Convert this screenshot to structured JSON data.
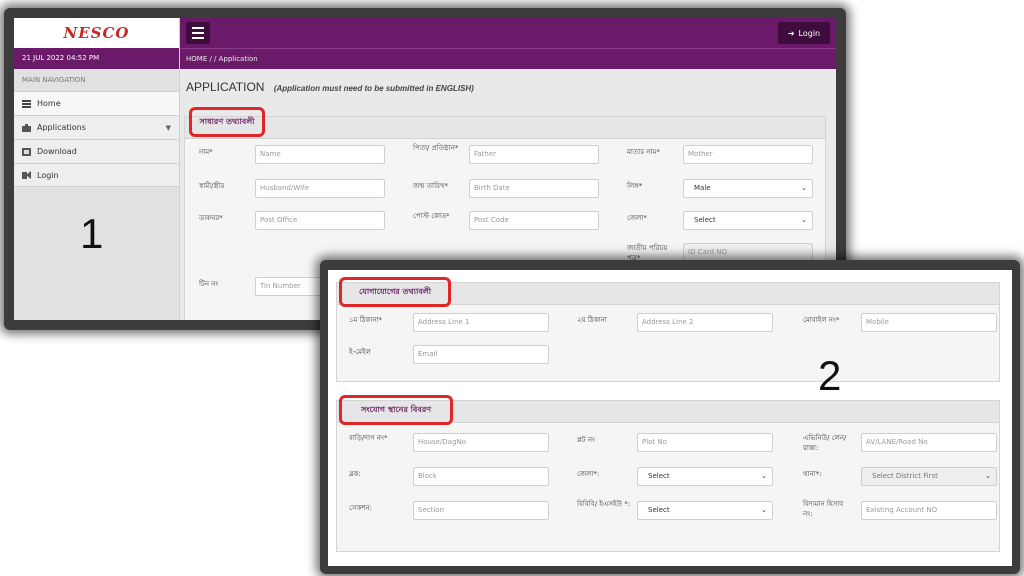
{
  "screen1": {
    "logo": "NESCO",
    "date": "21 JUL 2022 04:52 PM",
    "nav_heading": "MAIN NAVIGATION",
    "nav_items": [
      {
        "label": "Home",
        "icon": "list-icon"
      },
      {
        "label": "Applications",
        "icon": "briefcase-icon"
      },
      {
        "label": "Download",
        "icon": "download-icon"
      },
      {
        "label": "Login",
        "icon": "login-icon"
      }
    ],
    "big_number": "1",
    "login_button": "Login",
    "breadcrumb": "HOME  /   /  Application",
    "page_title": "APPLICATION",
    "page_note": "(Application must need to be submitted in ENGLISH)",
    "section_title": "সাধারণ তথ্যাবলী",
    "fields": {
      "name_label": "নাম*",
      "name_placeholder": "Name",
      "father_label": "পিতা/ প্রতিষ্ঠান*",
      "father_placeholder": "Father",
      "mother_label": "মাতার নাম*",
      "mother_placeholder": "Mother",
      "spouse_label": "স্বামী/স্ত্রীর",
      "spouse_placeholder": "Husband/Wife",
      "dob_label": "জন্ম তারিখ*",
      "dob_placeholder": "Birth Date",
      "gender_label": "লিঙ্গ*",
      "gender_value": "Male",
      "postoffice_label": "ডাকঘর*",
      "postoffice_placeholder": "Post Office",
      "postcode_label": "পোস্ট কোড*",
      "postcode_placeholder": "Post Code",
      "district_label": "জেলা*",
      "district_value": "Select",
      "nid_label": "জাতীয় পরিচয় পত্র*",
      "nid_placeholder": "ID Card NO",
      "tin_label": "টিন নং",
      "tin_placeholder": "Tin Number"
    }
  },
  "screen2": {
    "big_number": "2",
    "contact_title": "যোগাযোগের তথ্যাবলী",
    "contact": {
      "addr1_label": "১ম ঠিকানা*",
      "addr1_placeholder": "Address Line 1",
      "addr2_label": "২য় ঠিকানা",
      "addr2_placeholder": "Address Line 2",
      "mobile_label": "মোবাইল নং*",
      "mobile_placeholder": "Mobile",
      "email_label": "ই-মেইল",
      "email_placeholder": "Email"
    },
    "conn_title": "সংযোগ স্থানের বিবরণ",
    "conn": {
      "house_label": "বাড়ি/দাগ নং*",
      "house_placeholder": "House/DagNo",
      "plot_label": "প্লট নং",
      "plot_placeholder": "Plot No",
      "avenue_label": "এভিনিউ/ লেন/রাস্তা:",
      "avenue_placeholder": "AV/LANE/Road No",
      "block_label": "ব্লক:",
      "block_placeholder": "Block",
      "district_label": "জেলা*:",
      "district_value": "Select",
      "thana_label": "থানা*:",
      "thana_value": "Select District First",
      "section_label": "সেকশন:",
      "section_placeholder": "Section",
      "bibi_label": "বিবিবি/ ইএসইউ *:",
      "bibi_value": "Select",
      "account_label": "বিদ্যমান হিসাব নং:",
      "account_placeholder": "Existing Account NO"
    }
  },
  "colors": {
    "brand_purple": "#6b1969",
    "dark_purple": "#3f0c3e",
    "highlight_red": "#e02626",
    "logo_red": "#c62828"
  }
}
